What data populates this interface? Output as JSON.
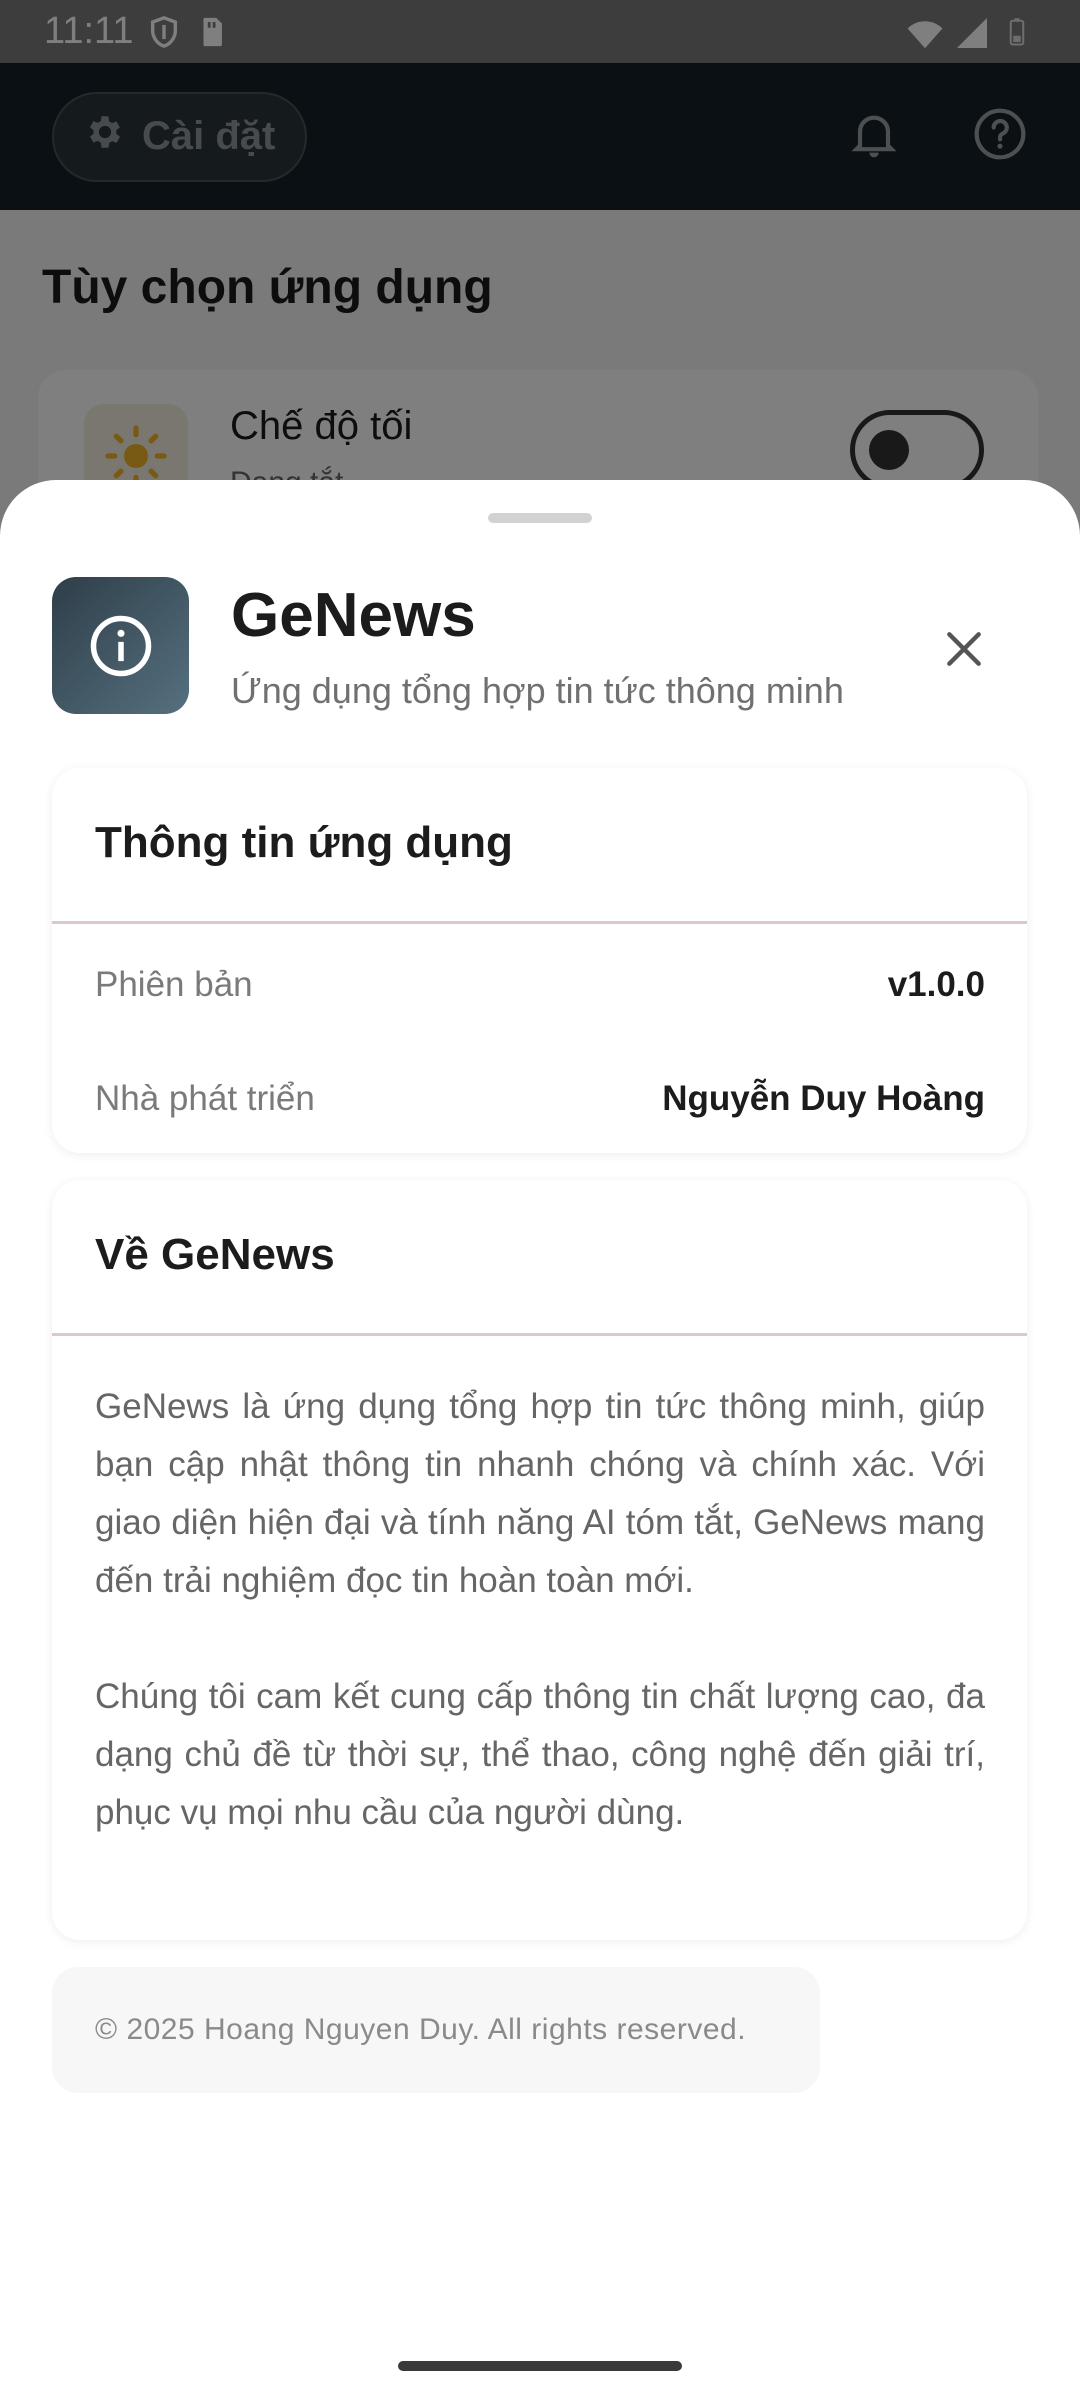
{
  "status_bar": {
    "time": "11:11",
    "icons": [
      "shield-icon",
      "sim-card-icon",
      "wifi-icon",
      "signal-icon",
      "battery-icon"
    ]
  },
  "app_bar": {
    "settings_label": "Cài đặt",
    "icons": [
      "gear-icon",
      "bell-icon",
      "help-icon"
    ]
  },
  "background": {
    "section_title": "Tùy chọn ứng dụng",
    "dark_mode": {
      "title": "Chế độ tối",
      "subtitle": "Đang tắt",
      "enabled": false
    }
  },
  "sheet": {
    "app_name": "GeNews",
    "tagline": "Ứng dụng tổng hợp tin tức thông minh",
    "info_card": {
      "title": "Thông tin ứng dụng",
      "rows": [
        {
          "label": "Phiên bản",
          "value": "v1.0.0"
        },
        {
          "label": "Nhà phát triển",
          "value": "Nguyễn Duy Hoàng"
        }
      ]
    },
    "about_card": {
      "title": "Về GeNews",
      "paragraphs": [
        "GeNews là ứng dụng tổng hợp tin tức thông minh, giúp bạn cập nhật thông tin nhanh chóng và chính xác. Với giao diện hiện đại và tính năng AI tóm tắt, GeNews mang đến trải nghiệm đọc tin hoàn toàn mới.",
        "Chúng tôi cam kết cung cấp thông tin chất lượng cao, đa dạng chủ đề từ thời sự, thể thao, công nghệ đến giải trí, phục vụ mọi nhu cầu của người dùng."
      ]
    },
    "footer": "© 2025 Hoang Nguyen Duy. All rights reserved."
  },
  "colors": {
    "header_icon_start": "#2e3e49",
    "header_icon_end": "#56707f",
    "divider": "#dcc7cf",
    "app_bar": "#172128"
  }
}
